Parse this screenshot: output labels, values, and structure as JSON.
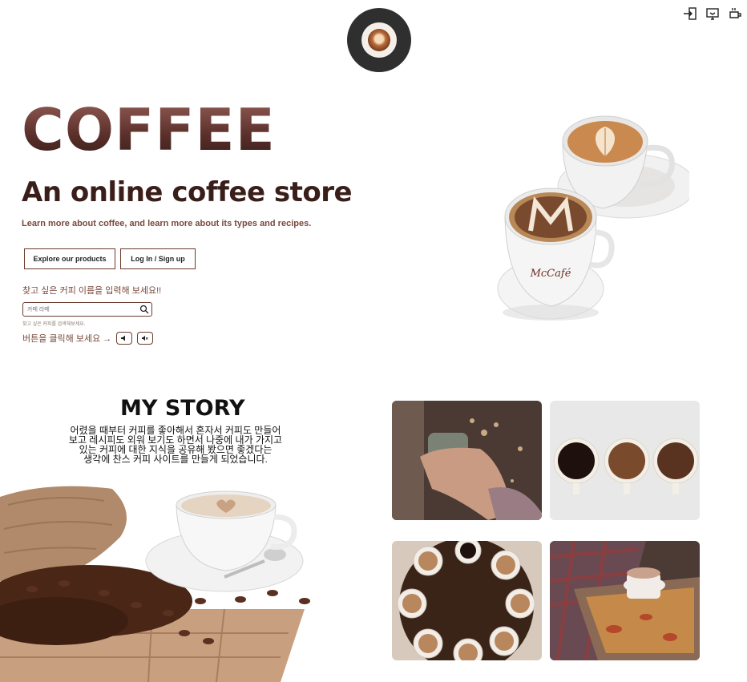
{
  "header": {
    "logo": "coffee-cup-logo",
    "icons": [
      "login-icon",
      "screen-icon",
      "coffee-mug-icon"
    ]
  },
  "hero": {
    "title": "COFFEE",
    "subtitle": "An online coffee store",
    "description": "Learn more about coffee, and learn more about its types and recipes.",
    "explore_label": "Explore our products",
    "login_label": "Log In / Sign up",
    "search_prompt": "찾고 싶은 커피 이름을 입력해 보세요!!",
    "search_placeholder": "카페 라떼",
    "search_hint": "찾고 싶은 커피를 검색해보세요.",
    "click_label": "버튼을 클릭해 보세요 →",
    "cup_brand": "McCafé"
  },
  "story": {
    "title": "MY STORY",
    "lines": [
      "어렸을 때부터 커피를 좋아해서 혼자서 커피도 만들어",
      "보고 레시피도 외워 보기도 하면서 나중에 내가 가지고",
      "있는 커피에 대한 지식을 공유해 봤으면 좋겠다는",
      "생각에 찬스 커피 사이트를 만들게 되었습니다."
    ]
  },
  "colors": {
    "brown": "#6b3b2e",
    "dark_brown": "#3a1e1a",
    "logo_bg": "#2f2f2f"
  }
}
